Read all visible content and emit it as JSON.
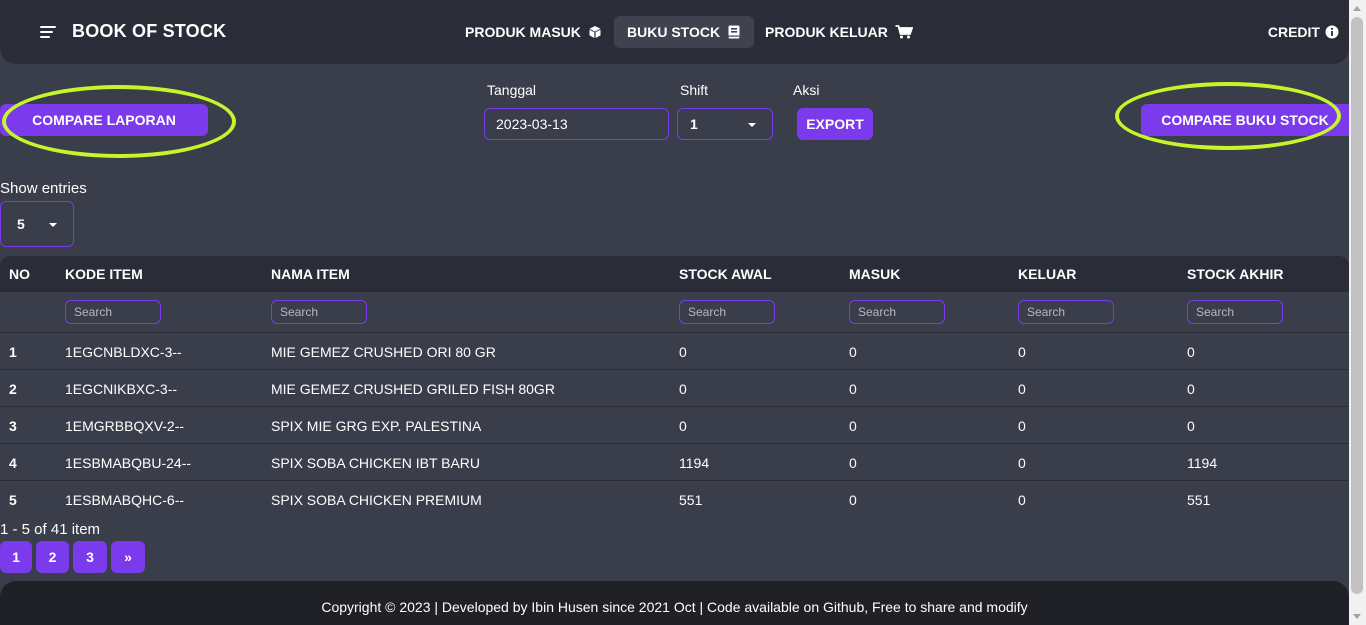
{
  "navbar": {
    "brand": "BOOK OF STOCK",
    "items": [
      {
        "label": "PRODUK MASUK",
        "icon": "cube-icon",
        "active": false
      },
      {
        "label": "BUKU STOCK",
        "icon": "book-icon",
        "active": true
      },
      {
        "label": "PRODUK KELUAR",
        "icon": "cart-icon",
        "active": false
      }
    ],
    "credit": "CREDIT"
  },
  "toolbar": {
    "compare_laporan": "COMPARE LAPORAN",
    "compare_buku_stock": "COMPARE BUKU STOCK",
    "tanggal_label": "Tanggal",
    "tanggal_value": "2023-03-13",
    "shift_label": "Shift",
    "shift_value": "1",
    "aksi_label": "Aksi",
    "export_label": "EXPORT",
    "highlight_color": "#c6f52a",
    "accent_color": "#7c3aed"
  },
  "entries": {
    "label": "Show entries",
    "value": "5"
  },
  "table": {
    "columns": [
      "NO",
      "KODE ITEM",
      "NAMA ITEM",
      "STOCK AWAL",
      "MASUK",
      "KELUAR",
      "STOCK AKHIR"
    ],
    "search_placeholder": "Search",
    "rows": [
      [
        "1",
        "1EGCNBLDXC-3--",
        "MIE GEMEZ CRUSHED ORI 80 GR",
        "0",
        "0",
        "0",
        "0"
      ],
      [
        "2",
        "1EGCNIKBXC-3--",
        "MIE GEMEZ CRUSHED GRILED FISH 80GR",
        "0",
        "0",
        "0",
        "0"
      ],
      [
        "3",
        "1EMGRBBQXV-2--",
        "SPIX MIE GRG EXP. PALESTINA",
        "0",
        "0",
        "0",
        "0"
      ],
      [
        "4",
        "1ESBMABQBU-24--",
        "SPIX SOBA CHICKEN IBT BARU",
        "1194",
        "0",
        "0",
        "1194"
      ],
      [
        "5",
        "1ESBMABQHC-6--",
        "SPIX SOBA CHICKEN PREMIUM",
        "551",
        "0",
        "0",
        "551"
      ]
    ]
  },
  "pagination": {
    "summary": "1 - 5 of 41 item",
    "pages": [
      "1",
      "2",
      "3"
    ],
    "next": "»"
  },
  "footer": {
    "text": "Copyright © 2023 | Developed by Ibin Husen since 2021 Oct | Code available on Github, Free to share and modify"
  }
}
